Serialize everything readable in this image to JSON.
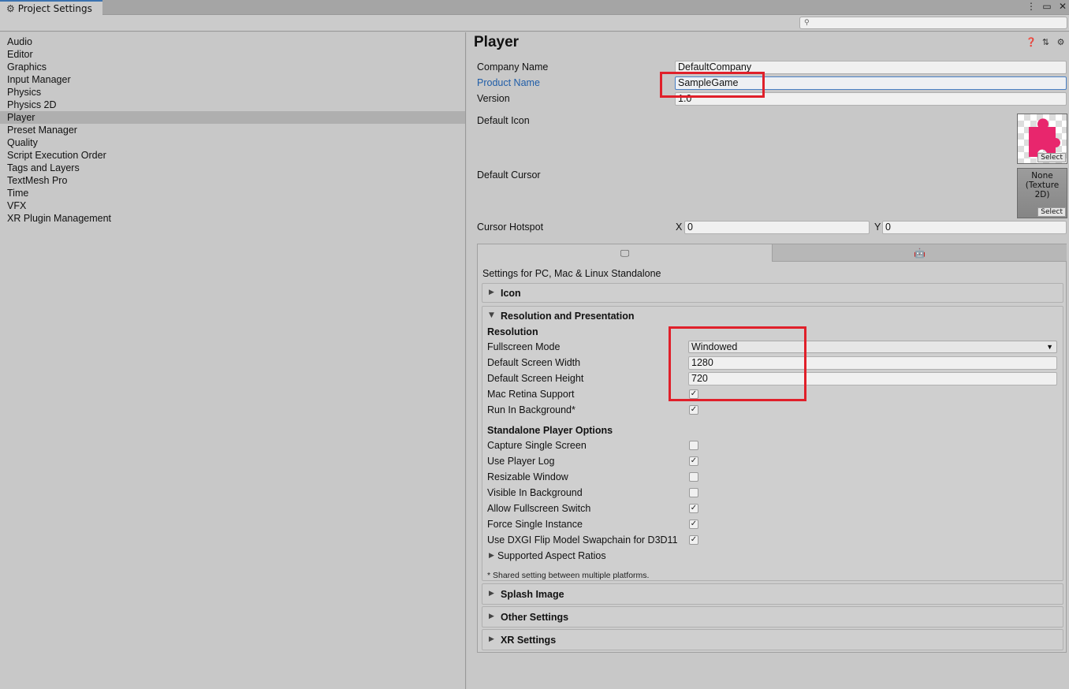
{
  "window": {
    "tab_title": "Project Settings",
    "tab_icon": "gear-icon",
    "controls": [
      "kebab-menu-icon",
      "maximize-icon",
      "close-icon"
    ]
  },
  "search": {
    "placeholder": ""
  },
  "sidebar": {
    "items": [
      {
        "label": "Audio"
      },
      {
        "label": "Editor"
      },
      {
        "label": "Graphics"
      },
      {
        "label": "Input Manager"
      },
      {
        "label": "Physics"
      },
      {
        "label": "Physics 2D"
      },
      {
        "label": "Player",
        "selected": true
      },
      {
        "label": "Preset Manager"
      },
      {
        "label": "Quality"
      },
      {
        "label": "Script Execution Order"
      },
      {
        "label": "Tags and Layers"
      },
      {
        "label": "TextMesh Pro"
      },
      {
        "label": "Time"
      },
      {
        "label": "VFX"
      },
      {
        "label": "XR Plugin Management"
      }
    ]
  },
  "main": {
    "title": "Player",
    "header_icons": [
      "help-icon",
      "presets-icon",
      "settings-icon"
    ],
    "company_name": {
      "label": "Company Name",
      "value": "DefaultCompany"
    },
    "product_name": {
      "label": "Product Name",
      "value": "SampleGame"
    },
    "version": {
      "label": "Version",
      "value": "1.0"
    },
    "default_icon": {
      "label": "Default Icon",
      "select_label": "Select"
    },
    "default_cursor": {
      "label": "Default Cursor",
      "value_line1": "None",
      "value_line2": "(Texture 2D)",
      "select_label": "Select"
    },
    "cursor_hotspot": {
      "label": "Cursor Hotspot",
      "x_label": "X",
      "x_value": "0",
      "y_label": "Y",
      "y_value": "0"
    },
    "platform_tabs": [
      {
        "icon": "monitor-icon",
        "active": true
      },
      {
        "icon": "android-icon",
        "active": false
      }
    ],
    "settings_for": "Settings for PC, Mac & Linux Standalone",
    "sections": {
      "icon": {
        "title": "Icon"
      },
      "resolution": {
        "title": "Resolution and Presentation",
        "resolution_header": "Resolution",
        "fullscreen_mode": {
          "label": "Fullscreen Mode",
          "value": "Windowed"
        },
        "default_width": {
          "label": "Default Screen Width",
          "value": "1280"
        },
        "default_height": {
          "label": "Default Screen Height",
          "value": "720"
        },
        "mac_retina": {
          "label": "Mac Retina Support",
          "checked": true
        },
        "run_in_background": {
          "label": "Run In Background*",
          "checked": true
        },
        "standalone_header": "Standalone Player Options",
        "standalone_options": [
          {
            "label": "Capture Single Screen",
            "checked": false
          },
          {
            "label": "Use Player Log",
            "checked": true
          },
          {
            "label": "Resizable Window",
            "checked": false
          },
          {
            "label": "Visible In Background",
            "checked": false
          },
          {
            "label": "Allow Fullscreen Switch",
            "checked": true
          },
          {
            "label": "Force Single Instance",
            "checked": true
          },
          {
            "label": "Use DXGI Flip Model Swapchain for D3D11",
            "checked": true
          }
        ],
        "supported_aspect_ratios": "Supported Aspect Ratios",
        "note": "* Shared setting between multiple platforms."
      },
      "splash": {
        "title": "Splash Image"
      },
      "other": {
        "title": "Other Settings"
      },
      "xr": {
        "title": "XR Settings"
      }
    }
  },
  "colors": {
    "highlight_box": "#e0202a",
    "link_label": "#1f5da8",
    "icon_pink": "#e8266d"
  }
}
